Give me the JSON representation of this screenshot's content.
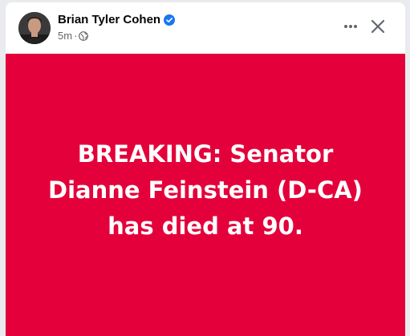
{
  "post": {
    "author": "Brian Tyler Cohen",
    "verified_icon": "verified-badge-icon",
    "time": "5m",
    "separator": "·",
    "audience_icon": "globe-icon",
    "more_icon": "more-options-icon",
    "close_icon": "close-icon",
    "banner_text": "BREAKING: Senator Dianne Feinstein (D-CA) has died at 90.",
    "colors": {
      "banner_background": "#e4003a",
      "banner_text": "#ffffff",
      "verified_blue": "#1877f2",
      "meta_gray": "#65676b"
    }
  }
}
